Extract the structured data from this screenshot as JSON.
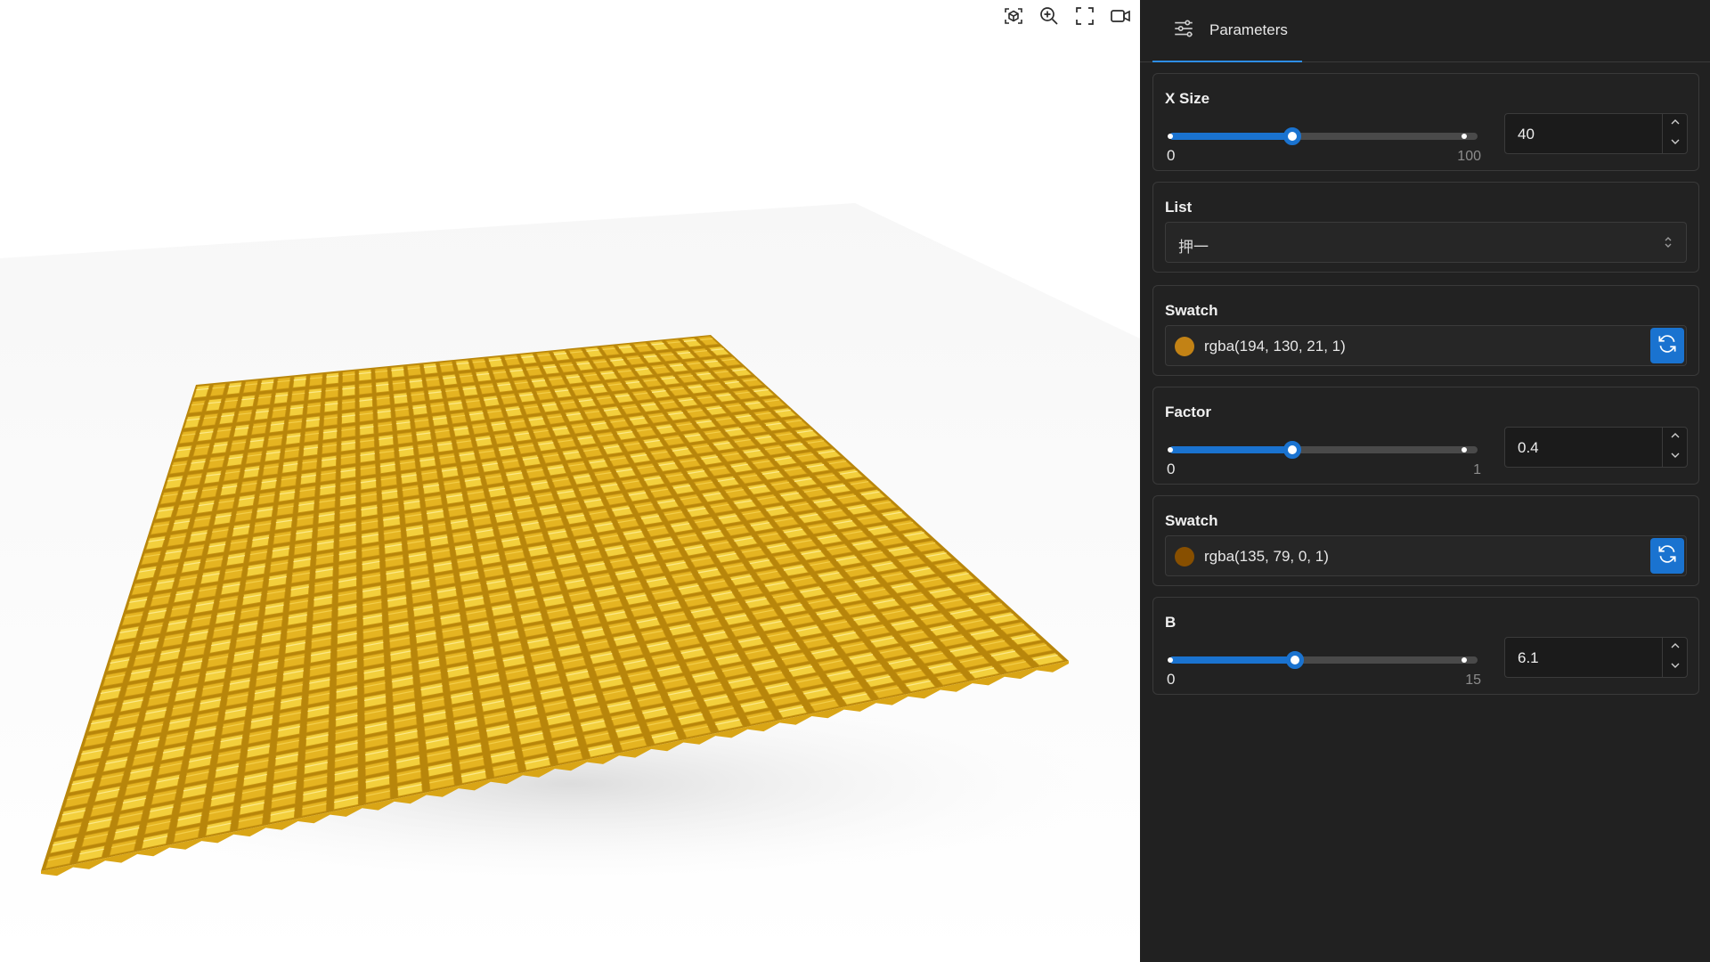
{
  "toolbar": {
    "icons": [
      "focus-object-icon",
      "zoom-in-icon",
      "fullscreen-icon",
      "record-video-icon"
    ]
  },
  "panel": {
    "tab_label": "Parameters",
    "tab_icon": "sliders-icon"
  },
  "params": {
    "x_size": {
      "label": "X Size",
      "min": "0",
      "max": "100",
      "value": "40",
      "fraction": 0.4
    },
    "list": {
      "label": "List",
      "selected": "押一"
    },
    "swatch1": {
      "label": "Swatch",
      "value": "rgba(194, 130, 21, 1)",
      "color": "#c28215"
    },
    "factor": {
      "label": "Factor",
      "min": "0",
      "max": "1",
      "value": "0.4",
      "fraction": 0.4
    },
    "swatch2": {
      "label": "Swatch",
      "value": "rgba(135, 79, 0, 1)",
      "color": "#874f00"
    },
    "b": {
      "label": "B",
      "min": "0",
      "max": "15",
      "value": "6.1",
      "fraction": 0.4067
    }
  },
  "colors": {
    "accent": "#1a73d0",
    "mesh": "#f0c22e",
    "panel_bg": "#212121"
  }
}
